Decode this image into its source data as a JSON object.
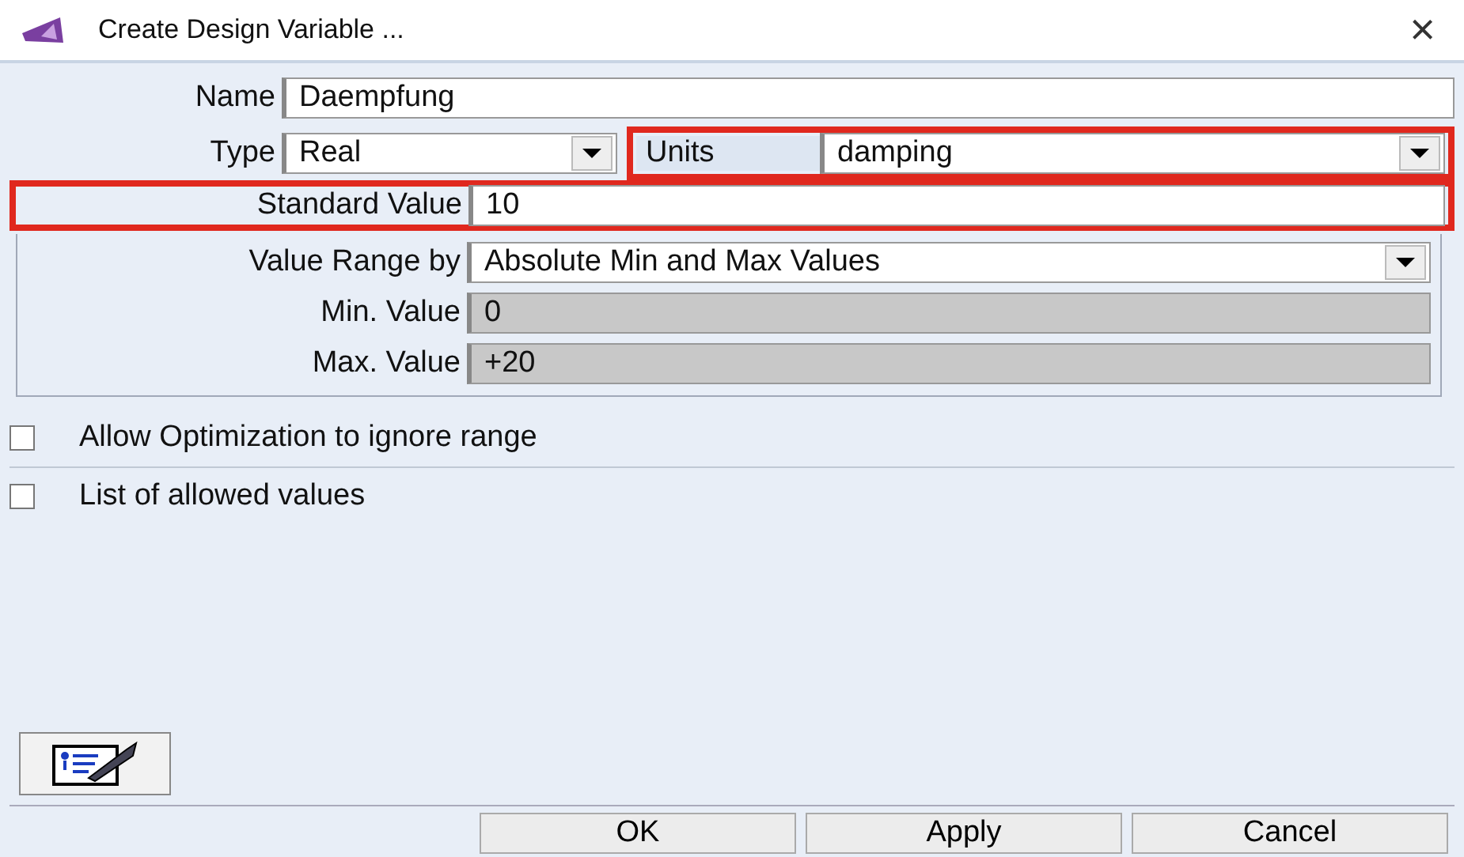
{
  "window": {
    "title": "Create Design Variable ...",
    "close": "×"
  },
  "name": {
    "label": "Name",
    "value": "Daempfung"
  },
  "type": {
    "label": "Type",
    "value": "Real"
  },
  "units": {
    "label": "Units",
    "value": "damping",
    "highlighted": true
  },
  "standard_value": {
    "label": "Standard Value",
    "value": "10",
    "highlighted": true
  },
  "value_range_by": {
    "label": "Value Range by",
    "value": "Absolute Min and Max Values"
  },
  "min_value": {
    "label": "Min. Value",
    "value": "0",
    "disabled": true
  },
  "max_value": {
    "label": "Max. Value",
    "value": "+20",
    "disabled": true
  },
  "checkboxes": [
    {
      "label": "Allow Optimization to ignore range",
      "checked": false
    },
    {
      "label": "List of allowed values",
      "checked": false
    }
  ],
  "buttons": [
    "OK",
    "Apply",
    "Cancel"
  ]
}
